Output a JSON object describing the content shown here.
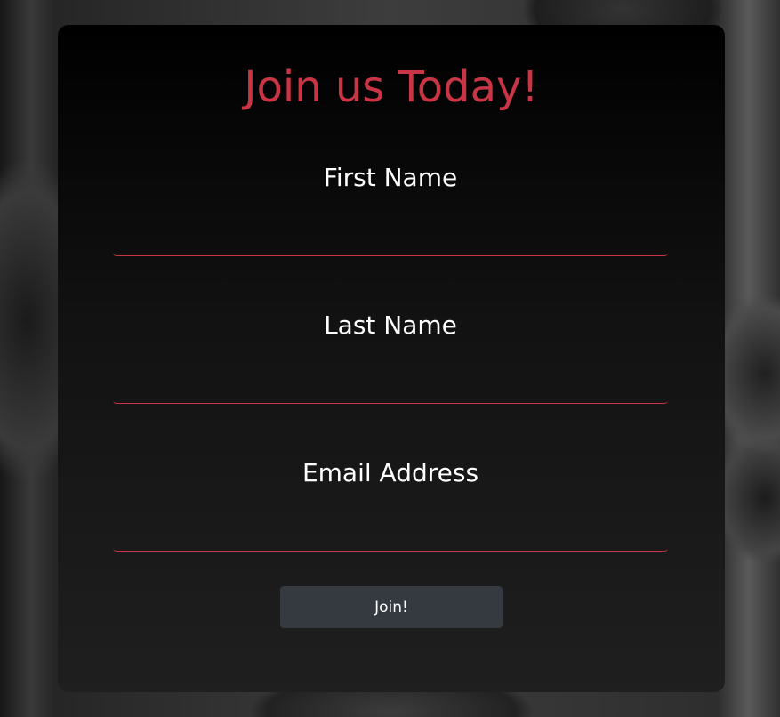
{
  "form": {
    "title": "Join us Today!",
    "fields": [
      {
        "label": "First Name",
        "value": "",
        "placeholder": ""
      },
      {
        "label": "Last Name",
        "value": "",
        "placeholder": ""
      },
      {
        "label": "Email Address",
        "value": "",
        "placeholder": ""
      }
    ],
    "submit_label": "Join!"
  },
  "colors": {
    "accent": "#c93545",
    "card_bg_top": "#000000",
    "card_bg_bottom": "#1f1f1f",
    "button_bg": "#343a40",
    "text": "#ffffff"
  }
}
